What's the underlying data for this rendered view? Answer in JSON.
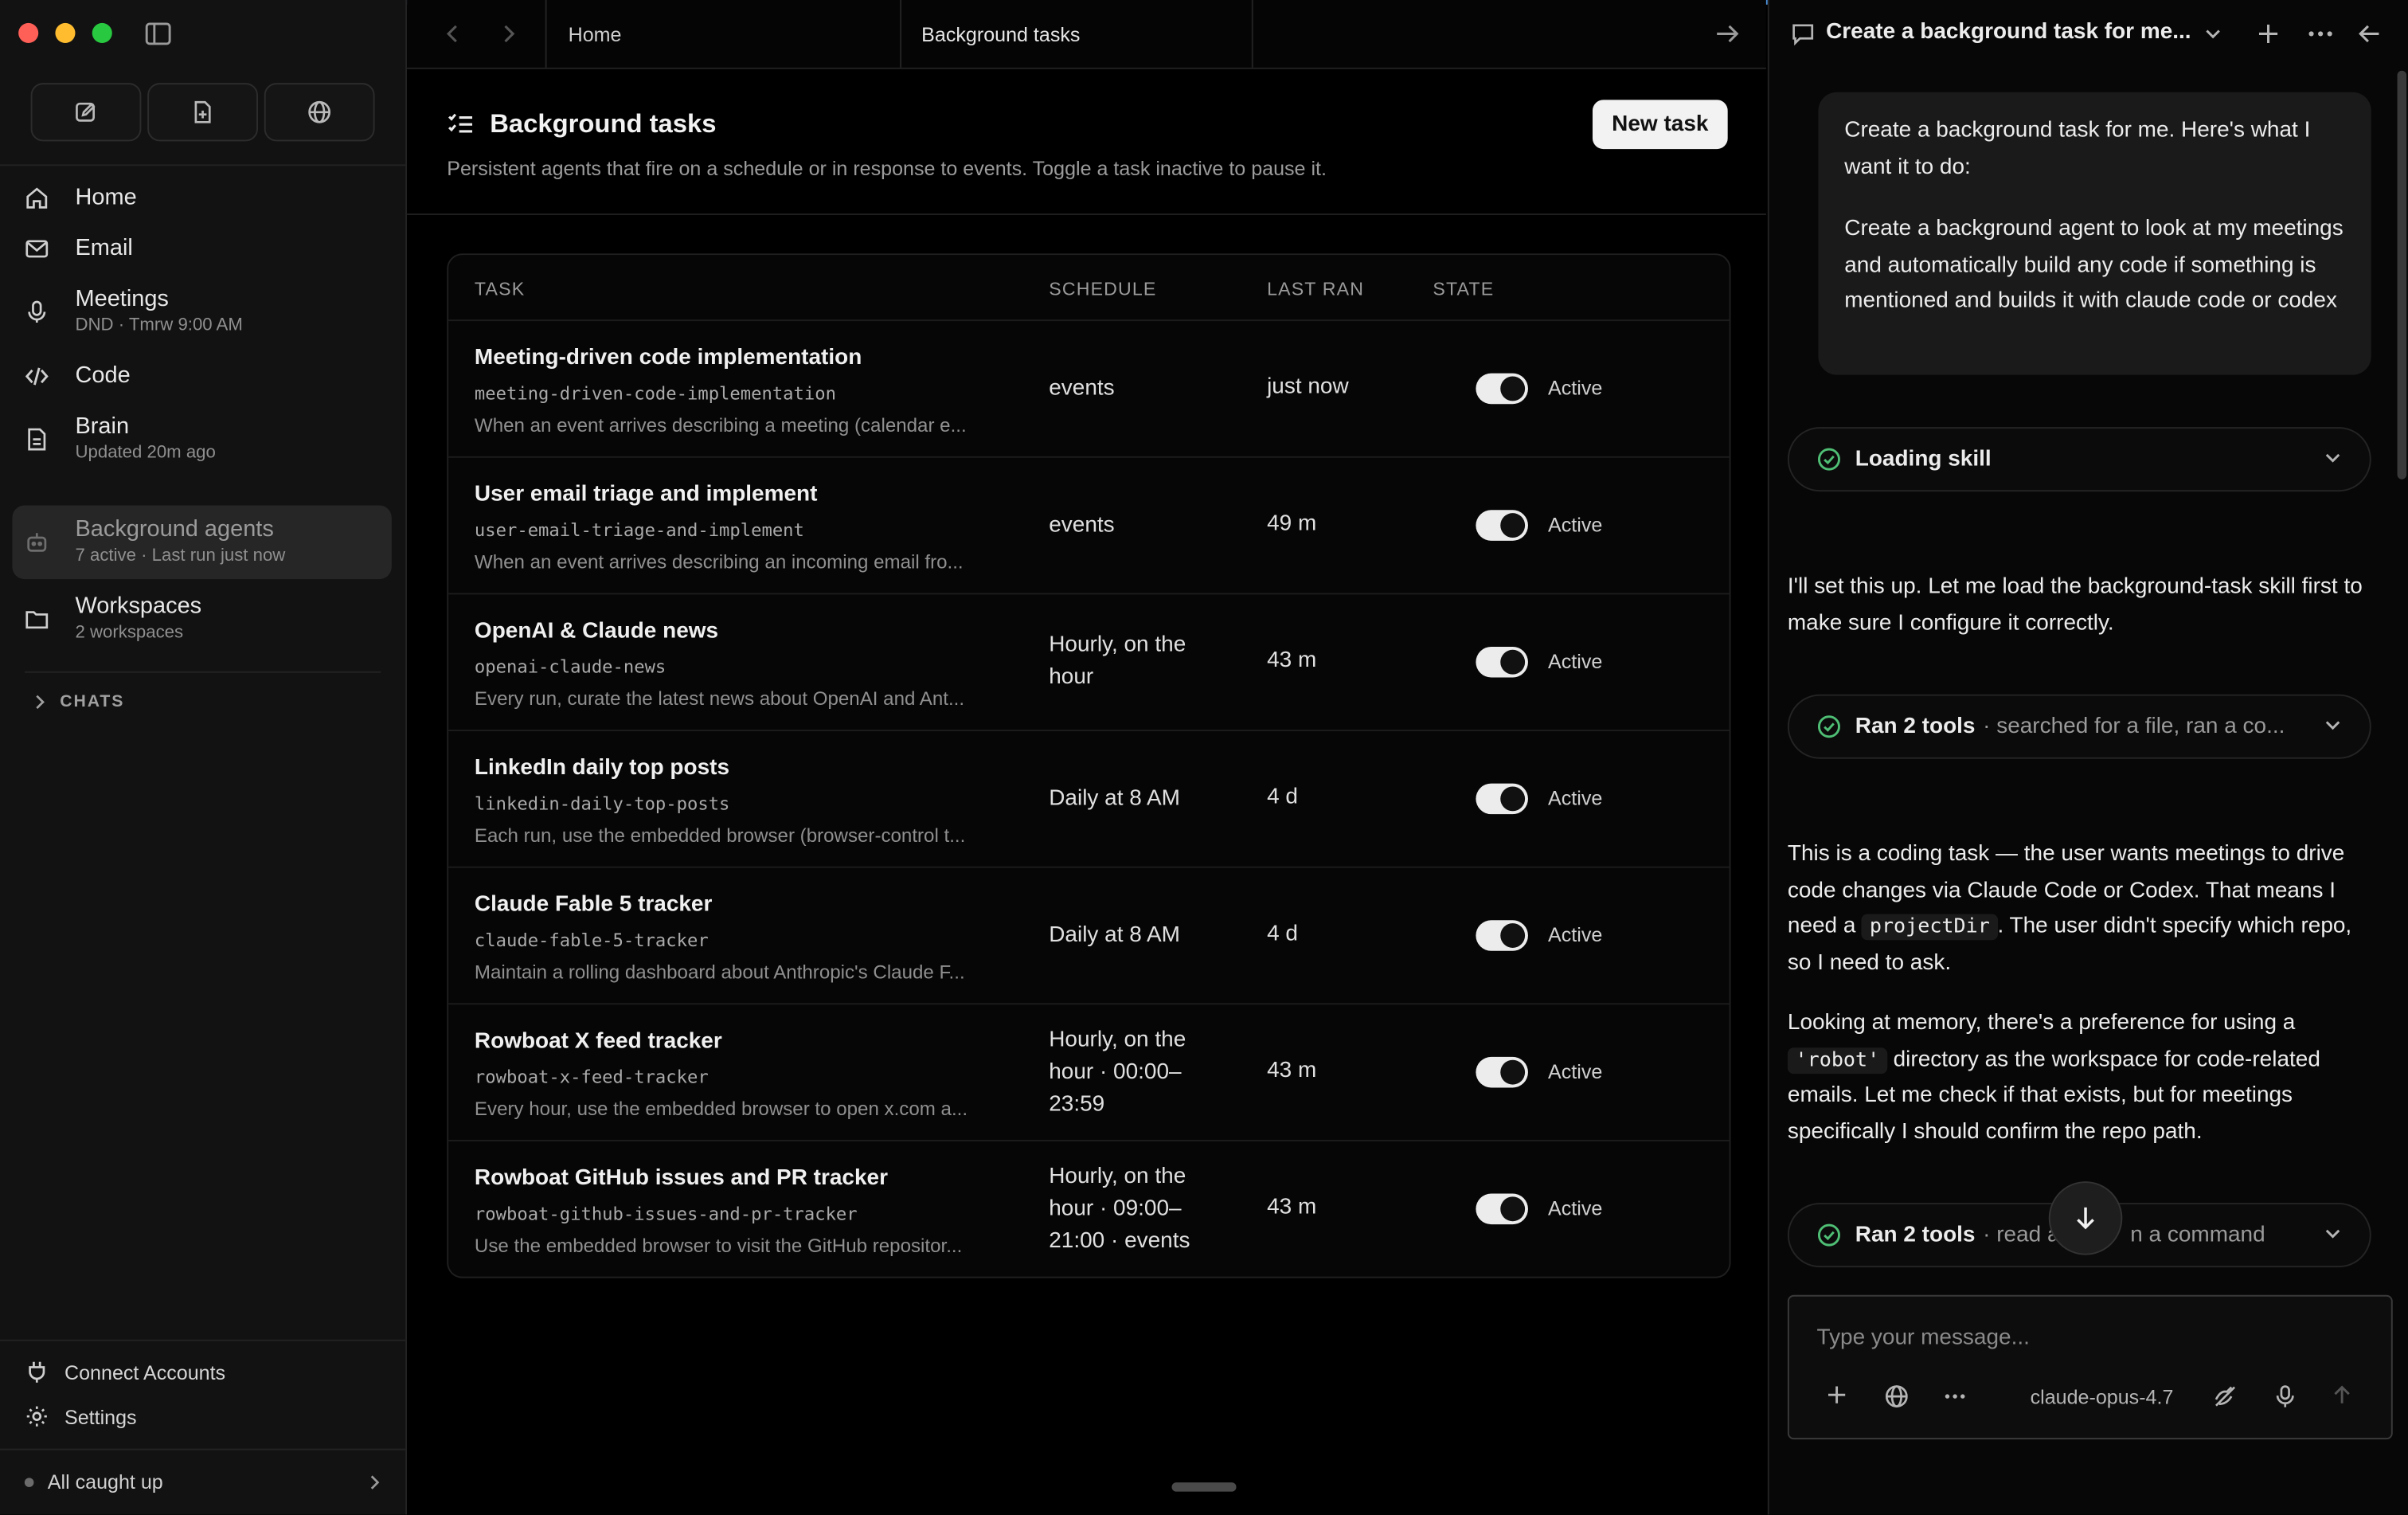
{
  "window": {
    "title": "Background tasks"
  },
  "sidebar": {
    "nav": [
      {
        "label": "Home",
        "sub": ""
      },
      {
        "label": "Email",
        "sub": ""
      },
      {
        "label": "Meetings",
        "sub": "DND · Tmrw 9:00 AM"
      },
      {
        "label": "Code",
        "sub": ""
      },
      {
        "label": "Brain",
        "sub": "Updated 20m ago"
      },
      {
        "label": "Background agents",
        "sub": "7 active · Last run just now"
      },
      {
        "label": "Workspaces",
        "sub": "2 workspaces"
      }
    ],
    "chats_label": "CHATS",
    "connect_accounts": "Connect Accounts",
    "settings": "Settings",
    "status": "All caught up"
  },
  "tabs": {
    "home": "Home",
    "background_tasks": "Background tasks"
  },
  "main": {
    "title": "Background tasks",
    "description": "Persistent agents that fire on a schedule or in response to events. Toggle a task inactive to pause it.",
    "new_task_button": "New task",
    "columns": {
      "task": "TASK",
      "schedule": "SCHEDULE",
      "last_ran": "LAST RAN",
      "state": "STATE"
    },
    "rows": [
      {
        "name": "Meeting-driven code implementation",
        "slug": "meeting-driven-code-implementation",
        "desc": "When an event arrives describing a meeting (calendar e...",
        "schedule": "events",
        "last_ran": "just now",
        "state": "Active",
        "active": true
      },
      {
        "name": "User email triage and implement",
        "slug": "user-email-triage-and-implement",
        "desc": "When an event arrives describing an incoming email fro...",
        "schedule": "events",
        "last_ran": "49 m",
        "state": "Active",
        "active": true
      },
      {
        "name": "OpenAI & Claude news",
        "slug": "openai-claude-news",
        "desc": "Every run, curate the latest news about OpenAI and Ant...",
        "schedule": "Hourly, on the hour",
        "last_ran": "43 m",
        "state": "Active",
        "active": true
      },
      {
        "name": "LinkedIn daily top posts",
        "slug": "linkedin-daily-top-posts",
        "desc": "Each run, use the embedded browser (browser-control t...",
        "schedule": "Daily at 8 AM",
        "last_ran": "4 d",
        "state": "Active",
        "active": true
      },
      {
        "name": "Claude Fable 5 tracker",
        "slug": "claude-fable-5-tracker",
        "desc": "Maintain a rolling dashboard about Anthropic's Claude F...",
        "schedule": "Daily at 8 AM",
        "last_ran": "4 d",
        "state": "Active",
        "active": true
      },
      {
        "name": "Rowboat X feed tracker",
        "slug": "rowboat-x-feed-tracker",
        "desc": "Every hour, use the embedded browser to open x.com a...",
        "schedule": "Hourly, on the hour · 00:00–23:59",
        "last_ran": "43 m",
        "state": "Active",
        "active": true
      },
      {
        "name": "Rowboat GitHub issues and PR tracker",
        "slug": "rowboat-github-issues-and-pr-tracker",
        "desc": "Use the embedded browser to visit the GitHub repositor...",
        "schedule": "Hourly, on the hour · 09:00–21:00 · events",
        "last_ran": "43 m",
        "state": "Active",
        "active": true
      }
    ]
  },
  "chat": {
    "title": "Create a background task for me...",
    "user_message_p1": "Create a background task for me. Here's what I want it to do:",
    "user_message_p2": "Create a background agent to look at my meetings and automatically build any code if something is mentioned and builds it with claude code or codex",
    "tool1": {
      "label": "Loading skill"
    },
    "assistant_p1": "I'll set this up. Let me load the background-task skill first to make sure I configure it correctly.",
    "tool2": {
      "label": "Ran 2 tools",
      "detail": "· searched for a file, ran a co..."
    },
    "assistant_p2_a": "This is a coding task — the user wants meetings to drive code changes via Claude Code or Codex. That means I need a ",
    "assistant_p2_code": "projectDir",
    "assistant_p2_b": ". The user didn't specify which repo, so I need to ask.",
    "assistant_p3_a": "Looking at memory, there's a preference for using a ",
    "assistant_p3_code": "'robot'",
    "assistant_p3_b": " directory as the workspace for code-related emails. Let me check if that exists, but for meetings specifically I should confirm the repo path.",
    "tool3": {
      "label": "Ran 2 tools",
      "detail": "· read a",
      "detail_tail": "n a command"
    },
    "composer_placeholder": "Type your message...",
    "model": "claude-opus-4.7"
  },
  "colors": {
    "accent_toggle": "#ececec",
    "success": "#4fbf75"
  },
  "icons": [
    "home-icon",
    "mail-icon",
    "mic-icon",
    "code-icon",
    "document-icon",
    "bot-icon",
    "folder-icon",
    "plug-icon",
    "gear-icon",
    "chat-bubble-icon",
    "plus-icon",
    "more-icon",
    "arrow-left-icon",
    "arrow-right-icon",
    "check-circle-icon",
    "chevron-down-icon",
    "globe-icon",
    "arrow-down-icon",
    "microphone-icon",
    "arrow-up-icon"
  ]
}
